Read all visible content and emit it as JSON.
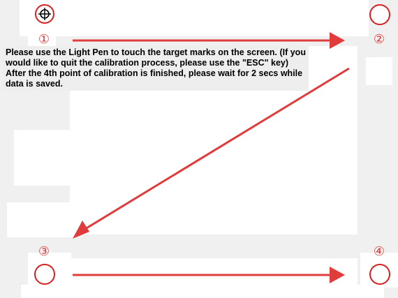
{
  "instructions": "Please use the Light Pen to touch the target marks on the screen. (If you would like to quit the calibration process, please use the \"ESC\" key) After the 4th point of calibration is finished, please wait for 2 secs while data is saved.",
  "points": {
    "p1": "①",
    "p2": "②",
    "p3": "③",
    "p4": "④"
  },
  "colors": {
    "accent": "#e03c3c",
    "target_active": "#d62020",
    "background": "#f0f0f0",
    "panel": "#ffffff"
  },
  "icons": {
    "target_active": "crosshair-target-icon",
    "target_pending": "circle-target-icon",
    "arrow": "arrow-icon"
  }
}
